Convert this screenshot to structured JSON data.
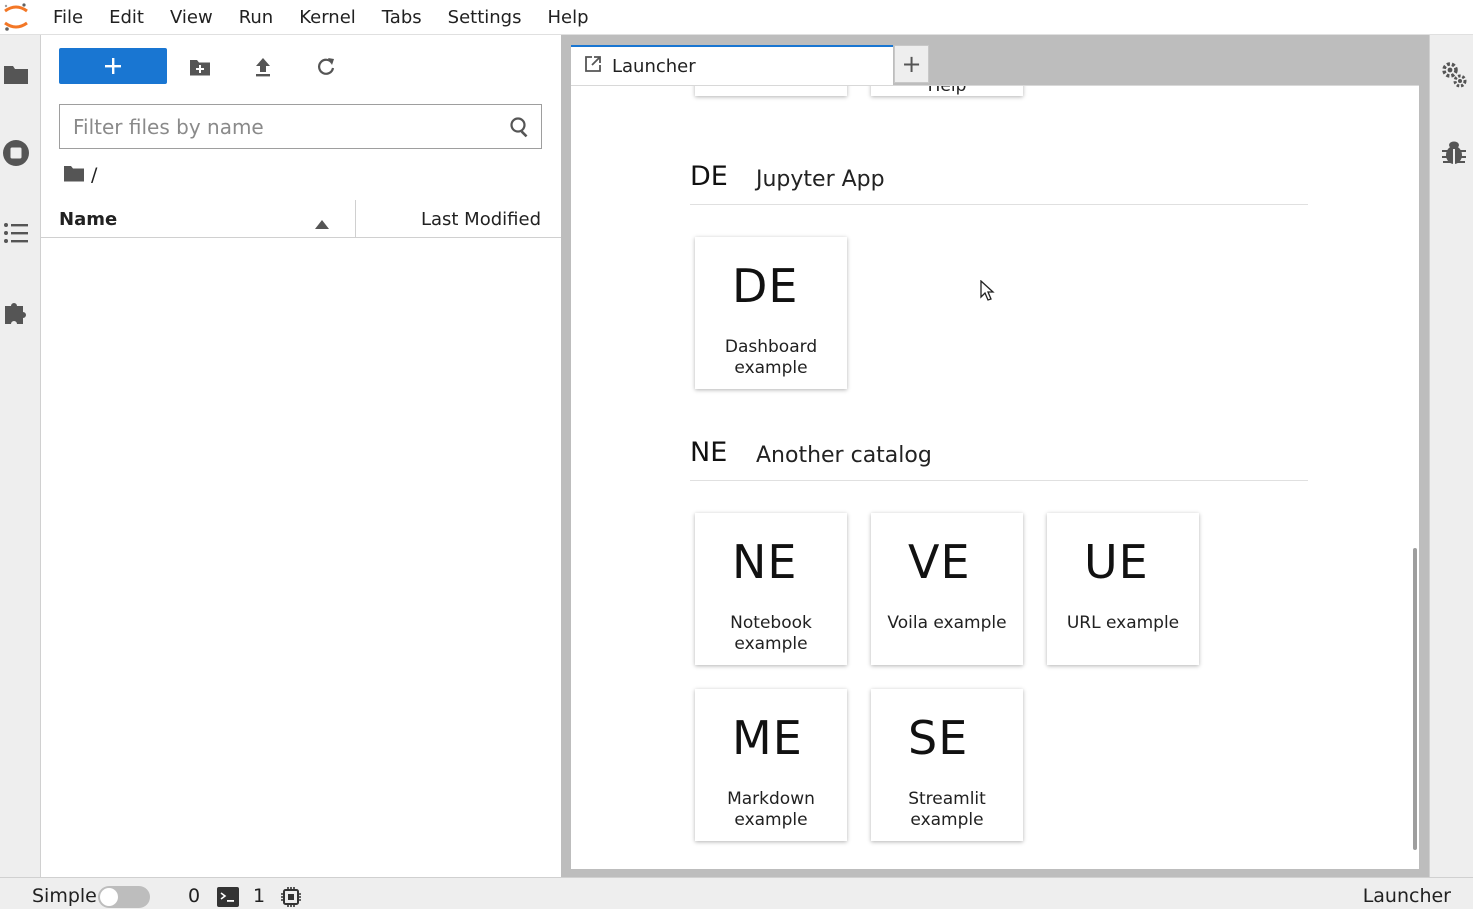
{
  "menubar": {
    "logo_icon": "jupyter-logo-icon",
    "items": [
      "File",
      "Edit",
      "View",
      "Run",
      "Kernel",
      "Tabs",
      "Settings",
      "Help"
    ]
  },
  "left_bar": {
    "icons": [
      "folder-icon",
      "running-stop-icon",
      "toc-list-icon",
      "extension-puzzle-icon"
    ]
  },
  "filebrowser": {
    "new_button_icon": "plus-icon",
    "toolbar_icons": [
      "new-folder-icon",
      "upload-icon",
      "refresh-icon"
    ],
    "filter_placeholder": "Filter files by name",
    "breadcrumb_path": "/",
    "columns": {
      "name": "Name",
      "modified": "Last Modified"
    }
  },
  "tabs": {
    "launcher_label": "Launcher",
    "add_tab_label": "+"
  },
  "launcher": {
    "partial_top_cards": [
      "",
      "Help"
    ],
    "sections": [
      {
        "abbr": "DE",
        "title": "Jupyter App",
        "cards": [
          {
            "abbr": "DE",
            "label_line1": "Dashboard",
            "label_line2": "example"
          }
        ]
      },
      {
        "abbr": "NE",
        "title": "Another catalog",
        "cards": [
          {
            "abbr": "NE",
            "label_line1": "Notebook",
            "label_line2": "example"
          },
          {
            "abbr": "VE",
            "label_line1": "Voila example",
            "label_line2": ""
          },
          {
            "abbr": "UE",
            "label_line1": "URL example",
            "label_line2": ""
          },
          {
            "abbr": "ME",
            "label_line1": "Markdown",
            "label_line2": "example"
          },
          {
            "abbr": "SE",
            "label_line1": "Streamlit",
            "label_line2": "example"
          }
        ]
      }
    ]
  },
  "right_bar": {
    "icons": [
      "property-inspector-gears-icon",
      "debugger-bug-icon"
    ]
  },
  "statusbar": {
    "mode_label": "Simple",
    "kernels_count": "0",
    "terminals_count": "1",
    "right_label": "Launcher"
  },
  "colors": {
    "accent": "#1976d2",
    "panel_bg": "#eeeeee",
    "dock_bg": "#bdbdbd"
  }
}
